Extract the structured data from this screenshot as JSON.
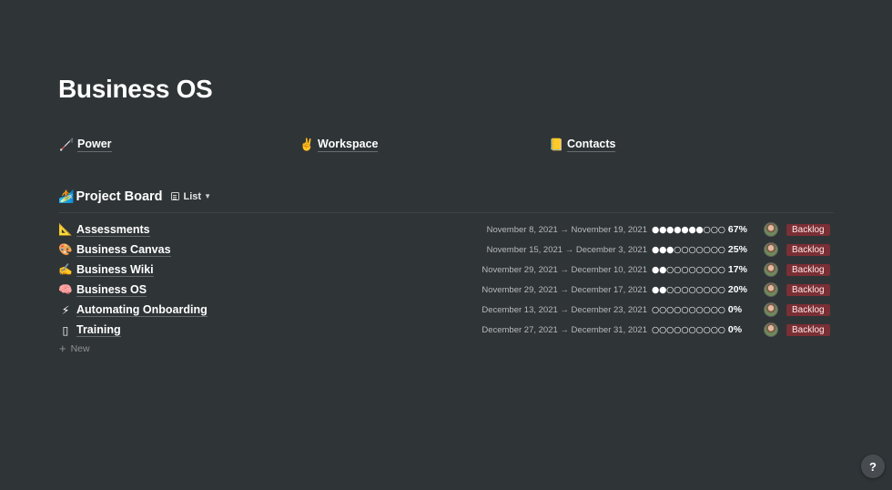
{
  "page": {
    "title": "Business OS"
  },
  "links": [
    {
      "emoji": "🦯",
      "label": "Power"
    },
    {
      "emoji": "✌️",
      "label": "Workspace"
    },
    {
      "emoji": "📒",
      "label": "Contacts"
    }
  ],
  "database": {
    "emoji": "🏄",
    "title": "Project Board",
    "view_label": "List",
    "new_label": "New",
    "rows": [
      {
        "emoji": "📐",
        "name": "Assessments",
        "dates": "November 8, 2021 → November 19, 2021",
        "dots": "●●●●●●●○○○",
        "progress_pct": "67%",
        "progress_fraction": 0.67,
        "status": "Backlog"
      },
      {
        "emoji": "🎨",
        "name": "Business Canvas",
        "dates": "November 15, 2021 → December 3, 2021",
        "dots": "●●●○○○○○○○",
        "progress_pct": "25%",
        "progress_fraction": 0.25,
        "status": "Backlog"
      },
      {
        "emoji": "✍️",
        "name": "Business Wiki",
        "dates": "November 29, 2021 → December 10, 2021",
        "dots": "●●○○○○○○○○",
        "progress_pct": "17%",
        "progress_fraction": 0.17,
        "status": "Backlog"
      },
      {
        "emoji": "🧠",
        "name": "Business OS",
        "dates": "November 29, 2021 → December 17, 2021",
        "dots": "●●○○○○○○○○",
        "progress_pct": "20%",
        "progress_fraction": 0.2,
        "status": "Backlog"
      },
      {
        "emoji": "⚡",
        "name": "Automating Onboarding",
        "dates": "December 13, 2021 → December 23, 2021",
        "dots": "○○○○○○○○○○",
        "progress_pct": "0%",
        "progress_fraction": 0.0,
        "status": "Backlog"
      },
      {
        "emoji": "▯",
        "name": "Training",
        "dates": "December 27, 2021 → December 31, 2021",
        "dots": "○○○○○○○○○○",
        "progress_pct": "0%",
        "progress_fraction": 0.0,
        "status": "Backlog"
      }
    ]
  },
  "help": {
    "label": "?"
  },
  "colors": {
    "background": "#2f3437",
    "status_backlog_bg": "#7a2f35",
    "status_backlog_text": "#ffe8e6"
  }
}
